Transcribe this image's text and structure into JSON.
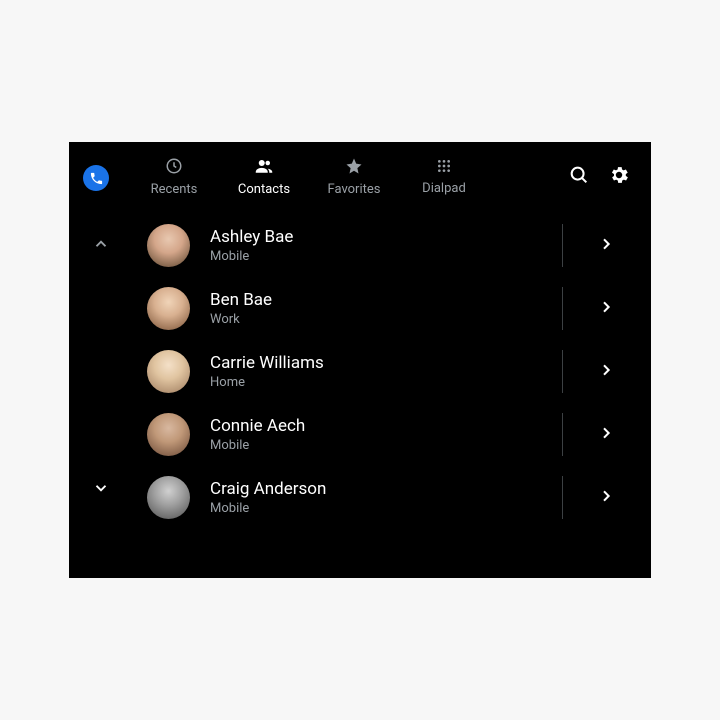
{
  "tabs": {
    "recents": "Recents",
    "contacts": "Contacts",
    "favorites": "Favorites",
    "dialpad": "Dialpad",
    "active": "contacts"
  },
  "contacts": [
    {
      "name": "Ashley Bae",
      "subtitle": "Mobile"
    },
    {
      "name": "Ben Bae",
      "subtitle": "Work"
    },
    {
      "name": "Carrie Williams",
      "subtitle": "Home"
    },
    {
      "name": "Connie Aech",
      "subtitle": "Mobile"
    },
    {
      "name": "Craig Anderson",
      "subtitle": "Mobile"
    }
  ]
}
